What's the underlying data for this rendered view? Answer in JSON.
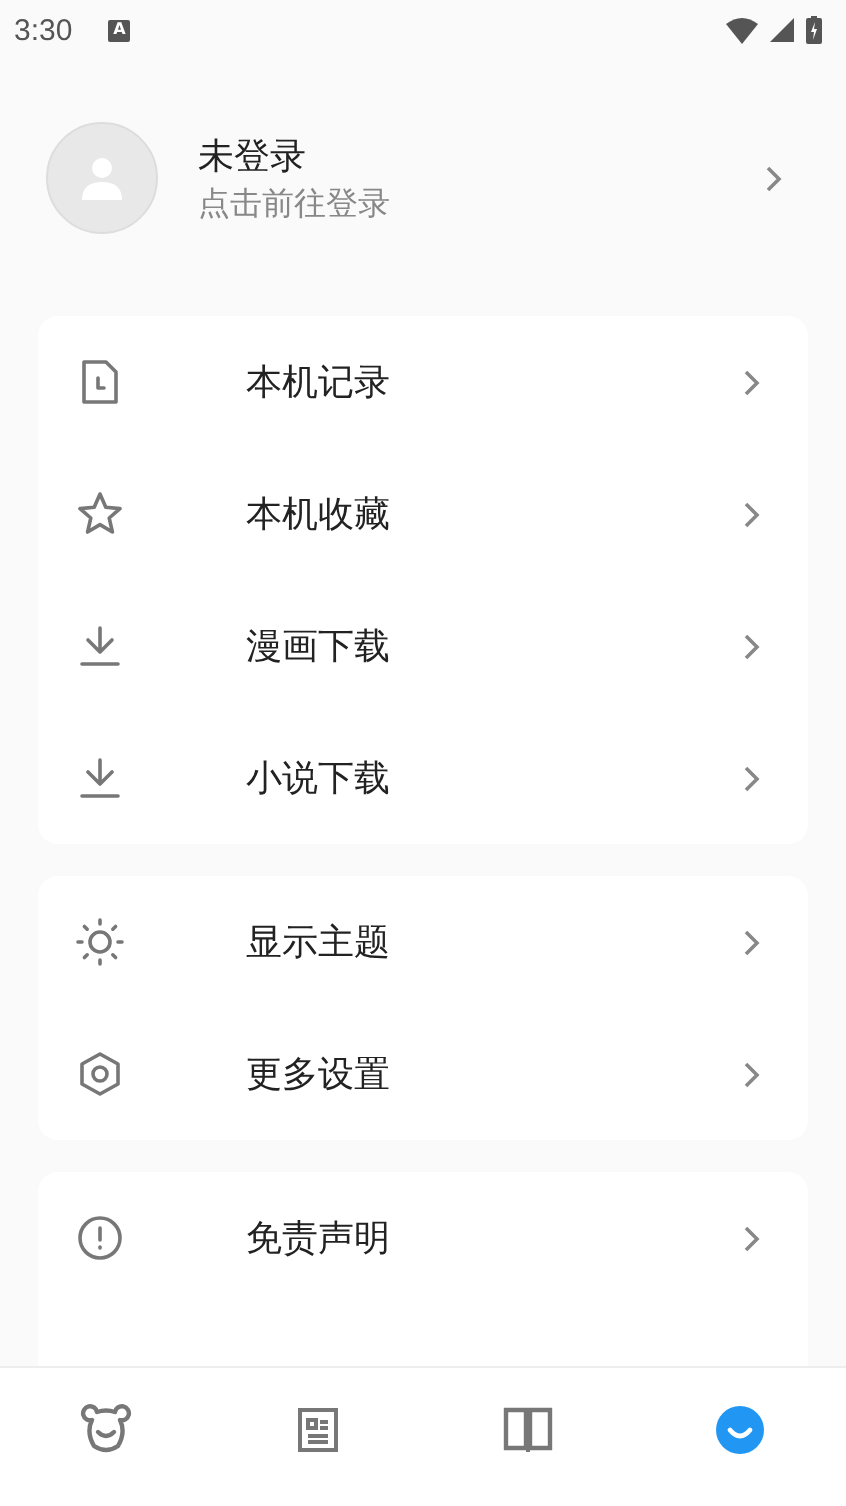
{
  "status_bar": {
    "time": "3:30",
    "notification": "A"
  },
  "profile": {
    "name": "未登录",
    "subtitle": "点击前往登录"
  },
  "groups": [
    {
      "items": [
        {
          "label": "本机记录"
        },
        {
          "label": "本机收藏"
        },
        {
          "label": "漫画下载"
        },
        {
          "label": "小说下载"
        }
      ]
    },
    {
      "items": [
        {
          "label": "显示主题"
        },
        {
          "label": "更多设置"
        }
      ]
    },
    {
      "items": [
        {
          "label": "免责声明"
        }
      ]
    }
  ],
  "bottom_nav": [
    {
      "selected": false
    },
    {
      "selected": false
    },
    {
      "selected": false
    },
    {
      "selected": true
    }
  ]
}
